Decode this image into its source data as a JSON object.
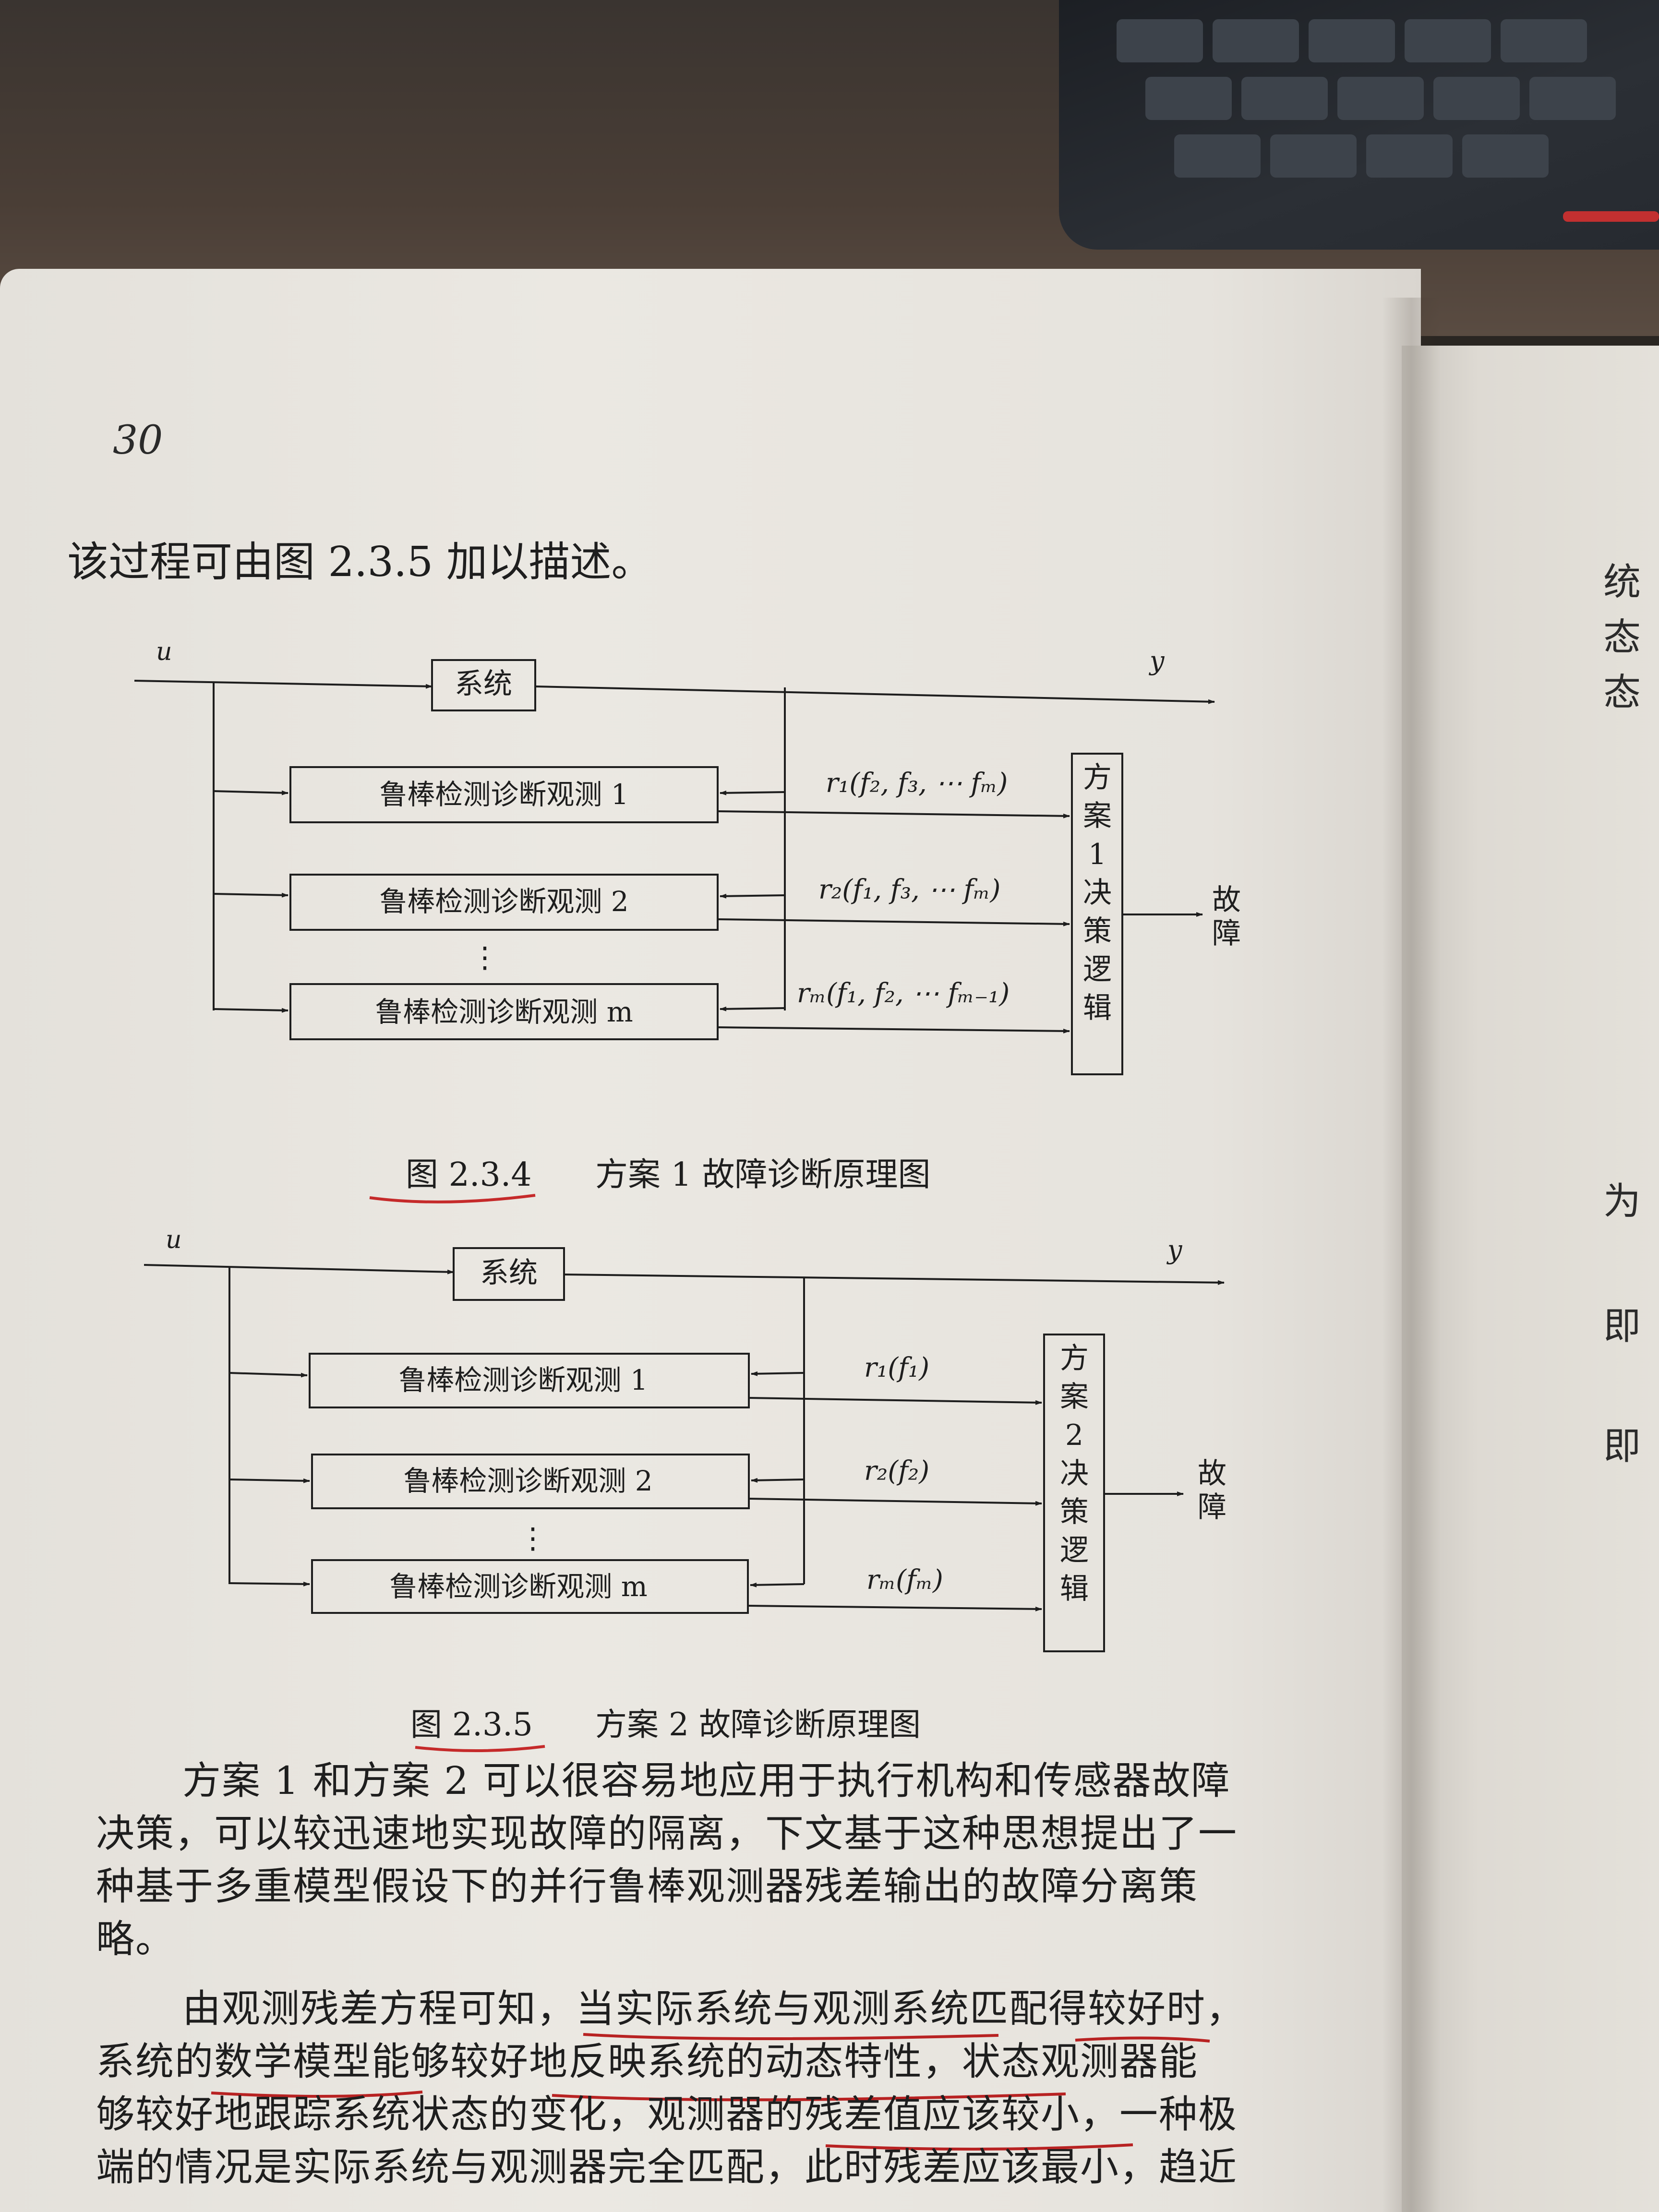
{
  "page": {
    "page_number": "30",
    "intro": "该过程可由图 2.3.5 加以描述。"
  },
  "figure1": {
    "input": "u",
    "output": "y",
    "system": "系统",
    "obs1": "鲁棒检测诊断观测 1",
    "obs2": "鲁棒检测诊断观测 2",
    "obsm": "鲁棒检测诊断观测 m",
    "dots": "⋮",
    "r1": "r₁(f₂, f₃, ⋯ fₘ)",
    "r2": "r₂(f₁, f₃, ⋯ fₘ)",
    "rm": "rₘ(f₁, f₂, ⋯ fₘ₋₁)",
    "decision": [
      "方",
      "案",
      "1",
      "决",
      "策",
      "逻",
      "辑"
    ],
    "fault": [
      "故",
      "障"
    ],
    "caption_num": "图 2.3.4",
    "caption_text": "方案 1 故障诊断原理图"
  },
  "figure2": {
    "input": "u",
    "output": "y",
    "system": "系统",
    "obs1": "鲁棒检测诊断观测 1",
    "obs2": "鲁棒检测诊断观测 2",
    "obsm": "鲁棒检测诊断观测 m",
    "dots": "⋮",
    "r1": "r₁(f₁)",
    "r2": "r₂(f₂)",
    "rm": "rₘ(fₘ)",
    "decision": [
      "方",
      "案",
      "2",
      "决",
      "策",
      "逻",
      "辑"
    ],
    "fault": [
      "故",
      "障"
    ],
    "caption_num": "图 2.3.5",
    "caption_text": "方案 2 故障诊断原理图"
  },
  "paragraphs": [
    "方案 1 和方案 2 可以很容易地应用于执行机构和传感器故障",
    "决策，可以较迅速地实现故障的隔离，下文基于这种思想提出了一",
    "种基于多重模型假设下的并行鲁棒观测器残差输出的故障分离策",
    "略。",
    "由观测残差方程可知，当实际系统与观测系统匹配得较好时，",
    "系统的数学模型能够较好地反映系统的动态特性，状态观测器能",
    "够较好地跟踪系统状态的变化，观测器的残差值应该较小，一种极",
    "端的情况是实际系统与观测器完全匹配，此时残差应该最小，趋近"
  ],
  "right_page_fragments": [
    "统",
    "态",
    "态",
    "为",
    "即",
    "即"
  ]
}
